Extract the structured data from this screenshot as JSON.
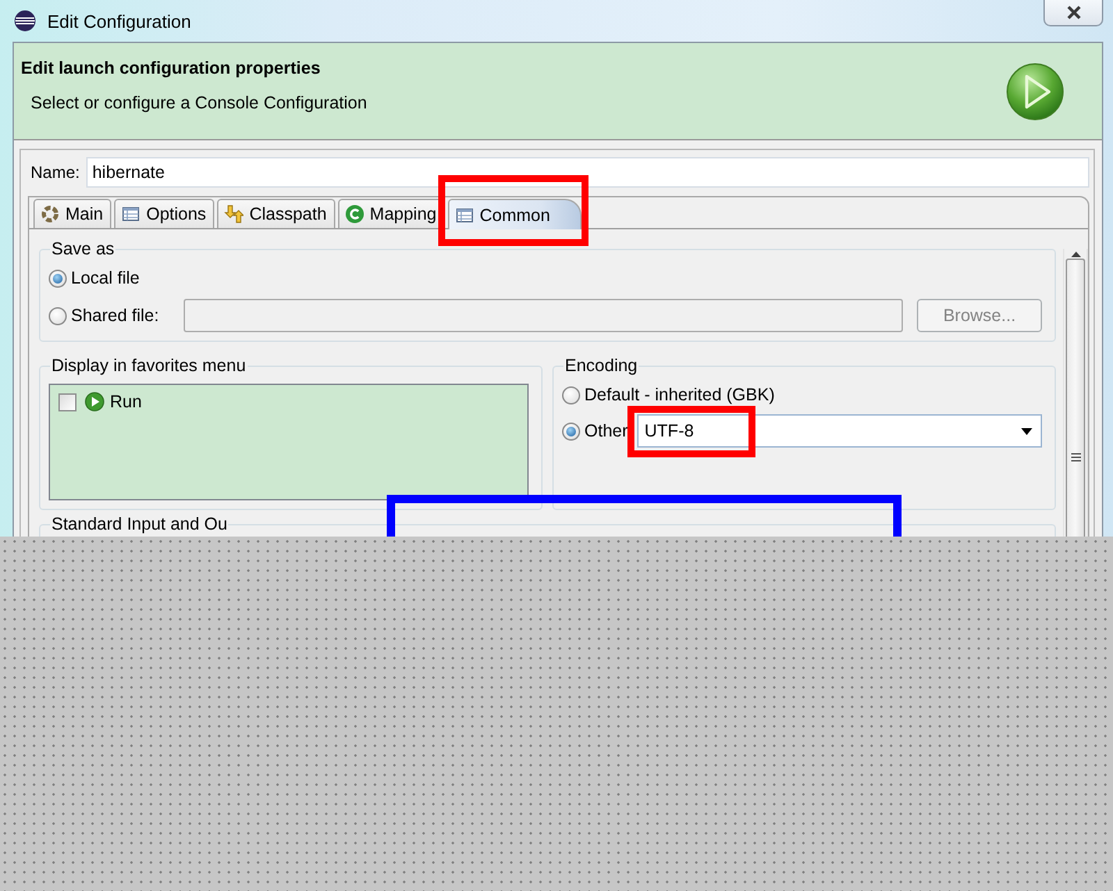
{
  "window": {
    "title": "Edit Configuration"
  },
  "header": {
    "title": "Edit launch configuration properties",
    "subtitle": "Select or configure a Console Configuration"
  },
  "name_field": {
    "label": "Name:",
    "value": "hibernate"
  },
  "tabs": [
    {
      "label": "Main",
      "selected": false,
      "highlighted": false
    },
    {
      "label": "Options",
      "selected": false,
      "highlighted": false
    },
    {
      "label": "Classpath",
      "selected": false,
      "highlighted": false
    },
    {
      "label": "Mapping",
      "selected": false,
      "highlighted": false
    },
    {
      "label": "Common",
      "selected": true,
      "highlighted": true
    }
  ],
  "save_as": {
    "label": "Save as",
    "options": [
      {
        "label": "Local file",
        "selected": true
      },
      {
        "label": "Shared file:",
        "selected": false
      }
    ],
    "shared_file_field": {
      "disabled": true
    },
    "browse_button": {
      "label": "Browse...",
      "disabled": true
    }
  },
  "favorites": {
    "label": "Display in favorites menu",
    "items": [
      {
        "label": "Run",
        "checked": false
      }
    ]
  },
  "encoding": {
    "label": "Encoding",
    "options": [
      {
        "label": "Default - inherited (GBK)",
        "selected": false
      },
      {
        "label": "Other",
        "selected": true
      }
    ],
    "other_value": {
      "value": "UTF-8",
      "highlighted": true
    }
  },
  "standard_io": {
    "label": "Standard Input and Ou",
    "callout": true
  }
}
